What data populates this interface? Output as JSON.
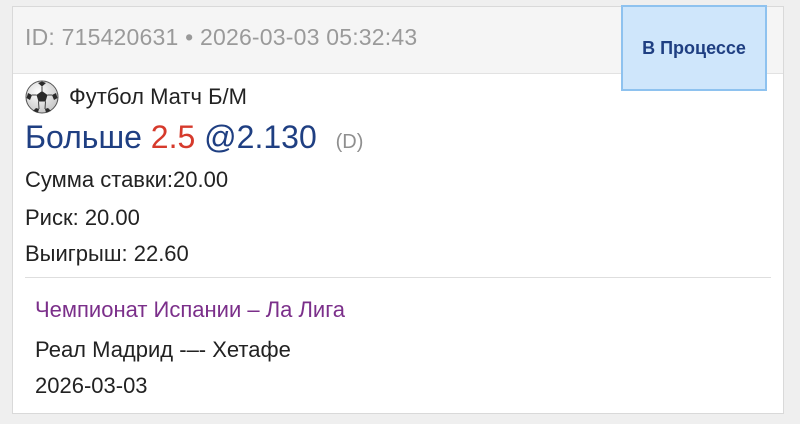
{
  "header": {
    "id_prefix": "ID: ",
    "bet_id": "715420631",
    "separator": " • ",
    "datetime": "2026-03-03 05:32:43"
  },
  "status": {
    "label": "В Процессе",
    "color": "#cfe6fb"
  },
  "sport": {
    "icon": "soccer-ball-icon",
    "market": "Футбол Матч Б/М"
  },
  "bet": {
    "selection": "Больше",
    "handicap": "2.5",
    "odds": "@2.130",
    "tag": "(D)"
  },
  "amounts": {
    "stake": "Сумма ставки:20.00",
    "risk": "Риск: 20.00",
    "win": "Выигрыш: 22.60"
  },
  "match": {
    "league": "Чемпионат Испании – Ла Лига",
    "teams": "Реал Мадрид -–- Хетафе",
    "date": "2026-03-03"
  }
}
